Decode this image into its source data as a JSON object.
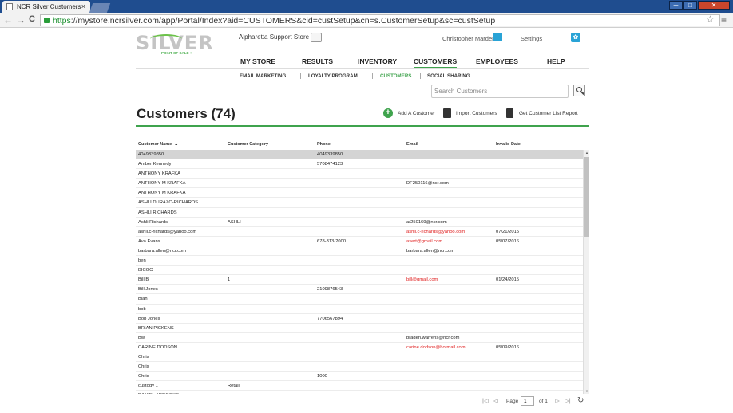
{
  "browser": {
    "tab_title": "NCR Silver Customers",
    "tab_close": "×",
    "url_https": "https",
    "url_rest": "://mystore.ncrsilver.com/app/Portal/Index?aid=CUSTOMERS&cid=custSetup&cn=s.CustomerSetup&sc=custSetup",
    "back": "←",
    "forward": "→",
    "reload": "C",
    "star": "☆",
    "menu": "≡",
    "min": "─",
    "max": "□",
    "close": "✕"
  },
  "header": {
    "logo_text": "SILVER",
    "logo_sub": "POINT OF SALE +",
    "store_name": "Alpharetta Support Store",
    "store_btn": "...",
    "user_name": "Christopher Marder",
    "settings_label": "Settings",
    "settings_glyph": "✿"
  },
  "main_nav": [
    "MY STORE",
    "RESULTS",
    "INVENTORY",
    "CUSTOMERS",
    "EMPLOYEES",
    "HELP"
  ],
  "active_nav": "CUSTOMERS",
  "sub_nav": [
    "EMAIL MARKETING",
    "LOYALTY PROGRAM",
    "CUSTOMERS",
    "SOCIAL SHARING"
  ],
  "search": {
    "placeholder": "Search Customers"
  },
  "page": {
    "title": "Customers (74)",
    "add_label": "Add A Customer",
    "add_glyph": "+",
    "import_label": "Import Customers",
    "report_label": "Get Customer List Report"
  },
  "columns": [
    "Customer Name",
    "Customer Category",
    "Phone",
    "Email",
    "Invalid Date"
  ],
  "sort_glyph": "▲",
  "rows": [
    {
      "name": "4049339850",
      "category": "",
      "phone": "4049339850",
      "email": "",
      "invalid": "",
      "selected": true
    },
    {
      "name": "Amber Kennedy",
      "category": "",
      "phone": "5708474123",
      "email": "",
      "invalid": ""
    },
    {
      "name": "ANTHONY KRAFKA",
      "category": "",
      "phone": "",
      "email": "",
      "invalid": ""
    },
    {
      "name": "ANTHONY M KRAFKA",
      "category": "",
      "phone": "",
      "email": "DF250116@ncr.com",
      "invalid": ""
    },
    {
      "name": "ANTHONY M KRAFKA",
      "category": "",
      "phone": "",
      "email": "",
      "invalid": ""
    },
    {
      "name": "ASHLI DURAZO-RICHARDS",
      "category": "",
      "phone": "",
      "email": "",
      "invalid": ""
    },
    {
      "name": "ASHLI RICHARDS",
      "category": "",
      "phone": "",
      "email": "",
      "invalid": ""
    },
    {
      "name": "Ashli Richards",
      "category": "ASHLI",
      "phone": "",
      "email": "ar250169@ncr.com",
      "invalid": ""
    },
    {
      "name": "ashli.c-richards@yahoo.com",
      "category": "",
      "phone": "",
      "email": "ashli.c-richards@yahoo.com",
      "invalid": "07/21/2015",
      "red": true
    },
    {
      "name": "Ava Evans",
      "category": "",
      "phone": "678-313-2000",
      "email": "asert@gmail.com",
      "invalid": "05/07/2016",
      "red": true
    },
    {
      "name": "barbara.allen@ncr.com",
      "category": "",
      "phone": "",
      "email": "barbara.allen@ncr.com",
      "invalid": ""
    },
    {
      "name": "ben",
      "category": "",
      "phone": "",
      "email": "",
      "invalid": ""
    },
    {
      "name": "BICGC",
      "category": "",
      "phone": "",
      "email": "",
      "invalid": ""
    },
    {
      "name": "Bill B",
      "category": "1",
      "phone": "",
      "email": "bill@gmail.com",
      "invalid": "01/24/2015",
      "red": true
    },
    {
      "name": "Bill Jones",
      "category": "",
      "phone": "2109876543",
      "email": "",
      "invalid": ""
    },
    {
      "name": "Blah",
      "category": "",
      "phone": "",
      "email": "",
      "invalid": ""
    },
    {
      "name": "bob",
      "category": "",
      "phone": "",
      "email": "",
      "invalid": ""
    },
    {
      "name": "Bob Jones",
      "category": "",
      "phone": "7706567894",
      "email": "",
      "invalid": ""
    },
    {
      "name": "BRIAN PICKENS",
      "category": "",
      "phone": "",
      "email": "",
      "invalid": ""
    },
    {
      "name": "Bw",
      "category": "",
      "phone": "",
      "email": "braden.warrens@ncr.com",
      "invalid": ""
    },
    {
      "name": "CARINE DODSON",
      "category": "",
      "phone": "",
      "email": "carine.dodson@hotmail.com",
      "invalid": "05/09/2016",
      "red": true
    },
    {
      "name": "Chris",
      "category": "",
      "phone": "",
      "email": "",
      "invalid": ""
    },
    {
      "name": "Chris",
      "category": "",
      "phone": "",
      "email": "",
      "invalid": ""
    },
    {
      "name": "Chris",
      "category": "",
      "phone": "1000",
      "email": "",
      "invalid": ""
    },
    {
      "name": "custody 1",
      "category": "Retail",
      "phone": "",
      "email": "",
      "invalid": ""
    },
    {
      "name": "DANIEL ARDOOKS",
      "category": "",
      "phone": "",
      "email": "",
      "invalid": ""
    }
  ],
  "pager": {
    "first": "|◁",
    "prev": "◁",
    "page_label": "Page",
    "page_value": "1",
    "of_label": "of 1",
    "next": "▷",
    "last": "▷|",
    "refresh": "↻"
  },
  "scroll": {
    "up": "▲",
    "down": "▼"
  },
  "colors": {
    "accent": "#3fa34d",
    "invalid_email": "#e02020",
    "brand_blue": "#29a3d6"
  }
}
